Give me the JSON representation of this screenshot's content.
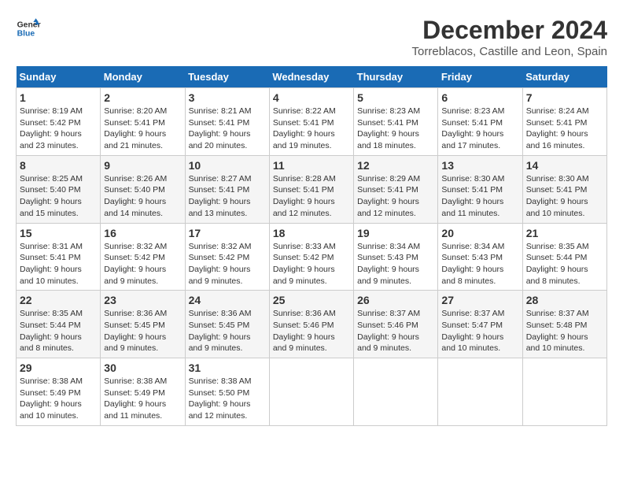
{
  "logo": {
    "line1": "General",
    "line2": "Blue"
  },
  "title": "December 2024",
  "subtitle": "Torreblacos, Castille and Leon, Spain",
  "days_of_week": [
    "Sunday",
    "Monday",
    "Tuesday",
    "Wednesday",
    "Thursday",
    "Friday",
    "Saturday"
  ],
  "weeks": [
    [
      {
        "day": "1",
        "sunrise": "8:19 AM",
        "sunset": "5:42 PM",
        "daylight": "9 hours and 23 minutes."
      },
      {
        "day": "2",
        "sunrise": "8:20 AM",
        "sunset": "5:41 PM",
        "daylight": "9 hours and 21 minutes."
      },
      {
        "day": "3",
        "sunrise": "8:21 AM",
        "sunset": "5:41 PM",
        "daylight": "9 hours and 20 minutes."
      },
      {
        "day": "4",
        "sunrise": "8:22 AM",
        "sunset": "5:41 PM",
        "daylight": "9 hours and 19 minutes."
      },
      {
        "day": "5",
        "sunrise": "8:23 AM",
        "sunset": "5:41 PM",
        "daylight": "9 hours and 18 minutes."
      },
      {
        "day": "6",
        "sunrise": "8:23 AM",
        "sunset": "5:41 PM",
        "daylight": "9 hours and 17 minutes."
      },
      {
        "day": "7",
        "sunrise": "8:24 AM",
        "sunset": "5:41 PM",
        "daylight": "9 hours and 16 minutes."
      }
    ],
    [
      {
        "day": "8",
        "sunrise": "8:25 AM",
        "sunset": "5:40 PM",
        "daylight": "9 hours and 15 minutes."
      },
      {
        "day": "9",
        "sunrise": "8:26 AM",
        "sunset": "5:40 PM",
        "daylight": "9 hours and 14 minutes."
      },
      {
        "day": "10",
        "sunrise": "8:27 AM",
        "sunset": "5:41 PM",
        "daylight": "9 hours and 13 minutes."
      },
      {
        "day": "11",
        "sunrise": "8:28 AM",
        "sunset": "5:41 PM",
        "daylight": "9 hours and 12 minutes."
      },
      {
        "day": "12",
        "sunrise": "8:29 AM",
        "sunset": "5:41 PM",
        "daylight": "9 hours and 12 minutes."
      },
      {
        "day": "13",
        "sunrise": "8:30 AM",
        "sunset": "5:41 PM",
        "daylight": "9 hours and 11 minutes."
      },
      {
        "day": "14",
        "sunrise": "8:30 AM",
        "sunset": "5:41 PM",
        "daylight": "9 hours and 10 minutes."
      }
    ],
    [
      {
        "day": "15",
        "sunrise": "8:31 AM",
        "sunset": "5:41 PM",
        "daylight": "9 hours and 10 minutes."
      },
      {
        "day": "16",
        "sunrise": "8:32 AM",
        "sunset": "5:42 PM",
        "daylight": "9 hours and 9 minutes."
      },
      {
        "day": "17",
        "sunrise": "8:32 AM",
        "sunset": "5:42 PM",
        "daylight": "9 hours and 9 minutes."
      },
      {
        "day": "18",
        "sunrise": "8:33 AM",
        "sunset": "5:42 PM",
        "daylight": "9 hours and 9 minutes."
      },
      {
        "day": "19",
        "sunrise": "8:34 AM",
        "sunset": "5:43 PM",
        "daylight": "9 hours and 9 minutes."
      },
      {
        "day": "20",
        "sunrise": "8:34 AM",
        "sunset": "5:43 PM",
        "daylight": "9 hours and 8 minutes."
      },
      {
        "day": "21",
        "sunrise": "8:35 AM",
        "sunset": "5:44 PM",
        "daylight": "9 hours and 8 minutes."
      }
    ],
    [
      {
        "day": "22",
        "sunrise": "8:35 AM",
        "sunset": "5:44 PM",
        "daylight": "9 hours and 8 minutes."
      },
      {
        "day": "23",
        "sunrise": "8:36 AM",
        "sunset": "5:45 PM",
        "daylight": "9 hours and 9 minutes."
      },
      {
        "day": "24",
        "sunrise": "8:36 AM",
        "sunset": "5:45 PM",
        "daylight": "9 hours and 9 minutes."
      },
      {
        "day": "25",
        "sunrise": "8:36 AM",
        "sunset": "5:46 PM",
        "daylight": "9 hours and 9 minutes."
      },
      {
        "day": "26",
        "sunrise": "8:37 AM",
        "sunset": "5:46 PM",
        "daylight": "9 hours and 9 minutes."
      },
      {
        "day": "27",
        "sunrise": "8:37 AM",
        "sunset": "5:47 PM",
        "daylight": "9 hours and 10 minutes."
      },
      {
        "day": "28",
        "sunrise": "8:37 AM",
        "sunset": "5:48 PM",
        "daylight": "9 hours and 10 minutes."
      }
    ],
    [
      {
        "day": "29",
        "sunrise": "8:38 AM",
        "sunset": "5:49 PM",
        "daylight": "9 hours and 10 minutes."
      },
      {
        "day": "30",
        "sunrise": "8:38 AM",
        "sunset": "5:49 PM",
        "daylight": "9 hours and 11 minutes."
      },
      {
        "day": "31",
        "sunrise": "8:38 AM",
        "sunset": "5:50 PM",
        "daylight": "9 hours and 12 minutes."
      },
      null,
      null,
      null,
      null
    ]
  ],
  "labels": {
    "sunrise": "Sunrise:",
    "sunset": "Sunset:",
    "daylight": "Daylight:"
  }
}
